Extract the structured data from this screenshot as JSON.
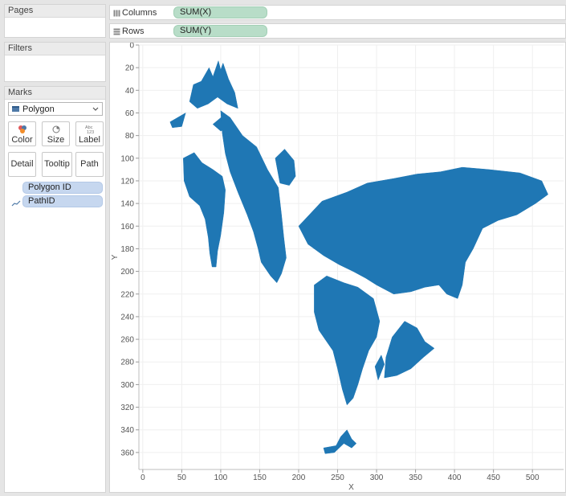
{
  "panels": {
    "pages": "Pages",
    "filters": "Filters",
    "marks": "Marks"
  },
  "marks": {
    "type_selected": "Polygon",
    "buttons": {
      "color": "Color",
      "size": "Size",
      "label": "Label",
      "detail": "Detail",
      "tooltip": "Tooltip",
      "path": "Path"
    },
    "pills": [
      "Polygon ID",
      "PathID"
    ]
  },
  "shelves": {
    "columns": {
      "label": "Columns",
      "pill": "SUM(X)"
    },
    "rows": {
      "label": "Rows",
      "pill": "SUM(Y)"
    }
  },
  "colors": {
    "mark": "#1f77b4",
    "columns_pill": "#b8ddc8",
    "marks_pill": "#c6d7ef"
  },
  "chart_data": {
    "type": "polygon",
    "xlabel": "X",
    "ylabel": "Y",
    "xlim": [
      -5,
      540
    ],
    "ylim": [
      0,
      375
    ],
    "y_reversed": true,
    "grid": true,
    "x_ticks": [
      0,
      50,
      100,
      150,
      200,
      250,
      300,
      350,
      400,
      450,
      500
    ],
    "y_ticks": [
      0,
      20,
      40,
      60,
      80,
      100,
      120,
      140,
      160,
      180,
      200,
      220,
      240,
      260,
      280,
      300,
      320,
      340,
      360
    ],
    "polygons": [
      {
        "name": "australia",
        "points": [
          [
            60,
            50
          ],
          [
            65,
            35
          ],
          [
            75,
            32
          ],
          [
            85,
            20
          ],
          [
            90,
            28
          ],
          [
            97,
            14
          ],
          [
            100,
            22
          ],
          [
            103,
            16
          ],
          [
            110,
            30
          ],
          [
            118,
            42
          ],
          [
            122,
            56
          ],
          [
            108,
            52
          ],
          [
            96,
            46
          ],
          [
            84,
            52
          ],
          [
            70,
            56
          ]
        ]
      },
      {
        "name": "new-zealand",
        "points": [
          [
            35,
            68
          ],
          [
            55,
            60
          ],
          [
            50,
            72
          ],
          [
            38,
            73
          ]
        ]
      },
      {
        "name": "new-guinea",
        "points": [
          [
            90,
            70
          ],
          [
            104,
            62
          ],
          [
            112,
            72
          ],
          [
            100,
            76
          ]
        ]
      },
      {
        "name": "south-america",
        "points": [
          [
            52,
            100
          ],
          [
            66,
            95
          ],
          [
            76,
            104
          ],
          [
            90,
            110
          ],
          [
            102,
            116
          ],
          [
            106,
            128
          ],
          [
            104,
            148
          ],
          [
            100,
            168
          ],
          [
            96,
            182
          ],
          [
            94,
            196
          ],
          [
            89,
            196
          ],
          [
            86,
            184
          ],
          [
            84,
            170
          ],
          [
            80,
            154
          ],
          [
            73,
            142
          ],
          [
            60,
            134
          ],
          [
            53,
            120
          ]
        ]
      },
      {
        "name": "north-america",
        "points": [
          [
            100,
            58
          ],
          [
            112,
            64
          ],
          [
            128,
            80
          ],
          [
            146,
            90
          ],
          [
            160,
            110
          ],
          [
            174,
            126
          ],
          [
            178,
            150
          ],
          [
            181,
            170
          ],
          [
            184,
            188
          ],
          [
            178,
            202
          ],
          [
            172,
            210
          ],
          [
            164,
            204
          ],
          [
            152,
            192
          ],
          [
            148,
            180
          ],
          [
            142,
            165
          ],
          [
            134,
            150
          ],
          [
            122,
            130
          ],
          [
            112,
            112
          ],
          [
            106,
            96
          ],
          [
            102,
            78
          ]
        ]
      },
      {
        "name": "greenland",
        "points": [
          [
            170,
            100
          ],
          [
            182,
            92
          ],
          [
            194,
            102
          ],
          [
            196,
            116
          ],
          [
            188,
            124
          ],
          [
            176,
            122
          ]
        ]
      },
      {
        "name": "eurasia",
        "points": [
          [
            200,
            160
          ],
          [
            230,
            138
          ],
          [
            262,
            130
          ],
          [
            288,
            122
          ],
          [
            322,
            118
          ],
          [
            352,
            114
          ],
          [
            382,
            112
          ],
          [
            410,
            108
          ],
          [
            444,
            110
          ],
          [
            484,
            113
          ],
          [
            512,
            120
          ],
          [
            520,
            132
          ],
          [
            504,
            140
          ],
          [
            480,
            150
          ],
          [
            456,
            155
          ],
          [
            436,
            162
          ],
          [
            424,
            180
          ],
          [
            414,
            192
          ],
          [
            410,
            212
          ],
          [
            404,
            224
          ],
          [
            390,
            220
          ],
          [
            380,
            212
          ],
          [
            362,
            214
          ],
          [
            344,
            218
          ],
          [
            322,
            220
          ],
          [
            300,
            212
          ],
          [
            286,
            206
          ],
          [
            270,
            200
          ],
          [
            252,
            194
          ],
          [
            232,
            186
          ],
          [
            212,
            176
          ]
        ]
      },
      {
        "name": "africa",
        "points": [
          [
            220,
            212
          ],
          [
            236,
            204
          ],
          [
            258,
            210
          ],
          [
            276,
            214
          ],
          [
            296,
            224
          ],
          [
            304,
            244
          ],
          [
            300,
            258
          ],
          [
            290,
            270
          ],
          [
            282,
            286
          ],
          [
            276,
            300
          ],
          [
            270,
            312
          ],
          [
            262,
            318
          ],
          [
            256,
            304
          ],
          [
            250,
            286
          ],
          [
            244,
            270
          ],
          [
            236,
            262
          ],
          [
            226,
            252
          ],
          [
            220,
            236
          ]
        ]
      },
      {
        "name": "antarctica",
        "points": [
          [
            320,
            258
          ],
          [
            336,
            244
          ],
          [
            352,
            250
          ],
          [
            362,
            262
          ],
          [
            374,
            268
          ],
          [
            360,
            276
          ],
          [
            344,
            286
          ],
          [
            326,
            292
          ],
          [
            310,
            294
          ],
          [
            312,
            276
          ]
        ]
      },
      {
        "name": "madagascar",
        "points": [
          [
            298,
            284
          ],
          [
            306,
            274
          ],
          [
            310,
            282
          ],
          [
            302,
            296
          ]
        ]
      },
      {
        "name": "tip-fragments",
        "points": [
          [
            232,
            356
          ],
          [
            248,
            354
          ],
          [
            254,
            346
          ],
          [
            262,
            340
          ],
          [
            268,
            348
          ],
          [
            274,
            352
          ],
          [
            268,
            356
          ],
          [
            258,
            352
          ],
          [
            246,
            360
          ],
          [
            234,
            361
          ]
        ]
      }
    ]
  }
}
